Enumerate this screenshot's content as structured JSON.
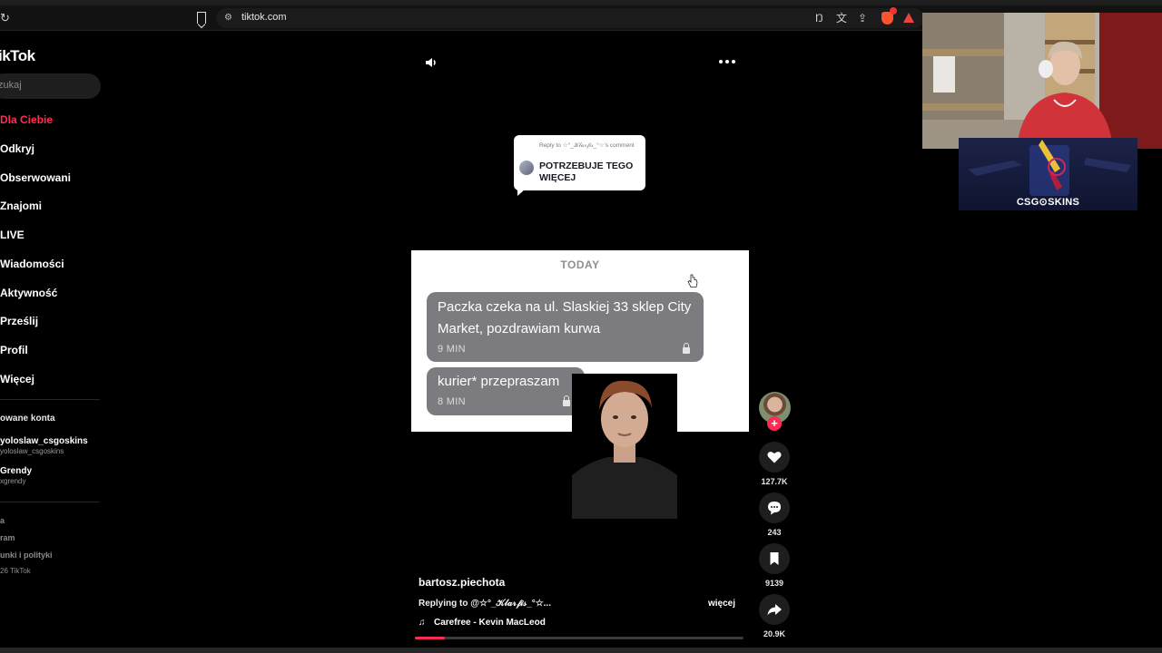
{
  "browser": {
    "url": "tiktok.com"
  },
  "sidebar": {
    "logo": "ikTok",
    "search_placeholder": "zukaj",
    "nav": [
      {
        "label": "Dla Ciebie",
        "active": true
      },
      {
        "label": "Odkryj"
      },
      {
        "label": "Obserwowani"
      },
      {
        "label": "Znajomi"
      },
      {
        "label": "LIVE"
      },
      {
        "label": "Wiadomości"
      },
      {
        "label": "Aktywność"
      },
      {
        "label": "Prześlij"
      },
      {
        "label": "Profil"
      },
      {
        "label": "Więcej"
      }
    ],
    "accounts_title": "owane konta",
    "accounts": [
      {
        "name": "yoloslaw_csgoskins",
        "handle": "yoloslaw_csgoskins"
      },
      {
        "name": "Grendy",
        "handle": "xgrendy"
      }
    ],
    "footer": [
      "a",
      "ram",
      "unki i polityki",
      "26 TikTok"
    ]
  },
  "video": {
    "reply_label": "Reply to ☆°_𝒦𝓁𝒶𝓇𝒻𝒾𝓈_°☆'s comment",
    "reply_text": "POTRZEBUJE TEGO WIĘCEJ",
    "sms": {
      "day": "TODAY",
      "messages": [
        {
          "text": "Paczka czeka na ul. Slaskiej 33 sklep City Market, pozdrawiam kurwa",
          "time": "9 MIN"
        },
        {
          "text": "kurier* przepraszam",
          "time": "8 MIN"
        }
      ]
    },
    "author": "bartosz.piechota",
    "caption": "Replying to @☆°_𝒦𝓁𝒶𝓇𝒻𝒾𝓈_°☆...",
    "more_label": "więcej",
    "music": "Carefree - Kevin MacLeod",
    "progress": 0.09
  },
  "actions": {
    "likes": "127.7K",
    "comments": "243",
    "saves": "9139",
    "shares": "20.9K"
  },
  "overlay": {
    "sponsor": "CSG⊙SKINS"
  },
  "colors": {
    "accent": "#fe2c55",
    "background": "#000000",
    "sms_bubble": "#7c7c80"
  }
}
